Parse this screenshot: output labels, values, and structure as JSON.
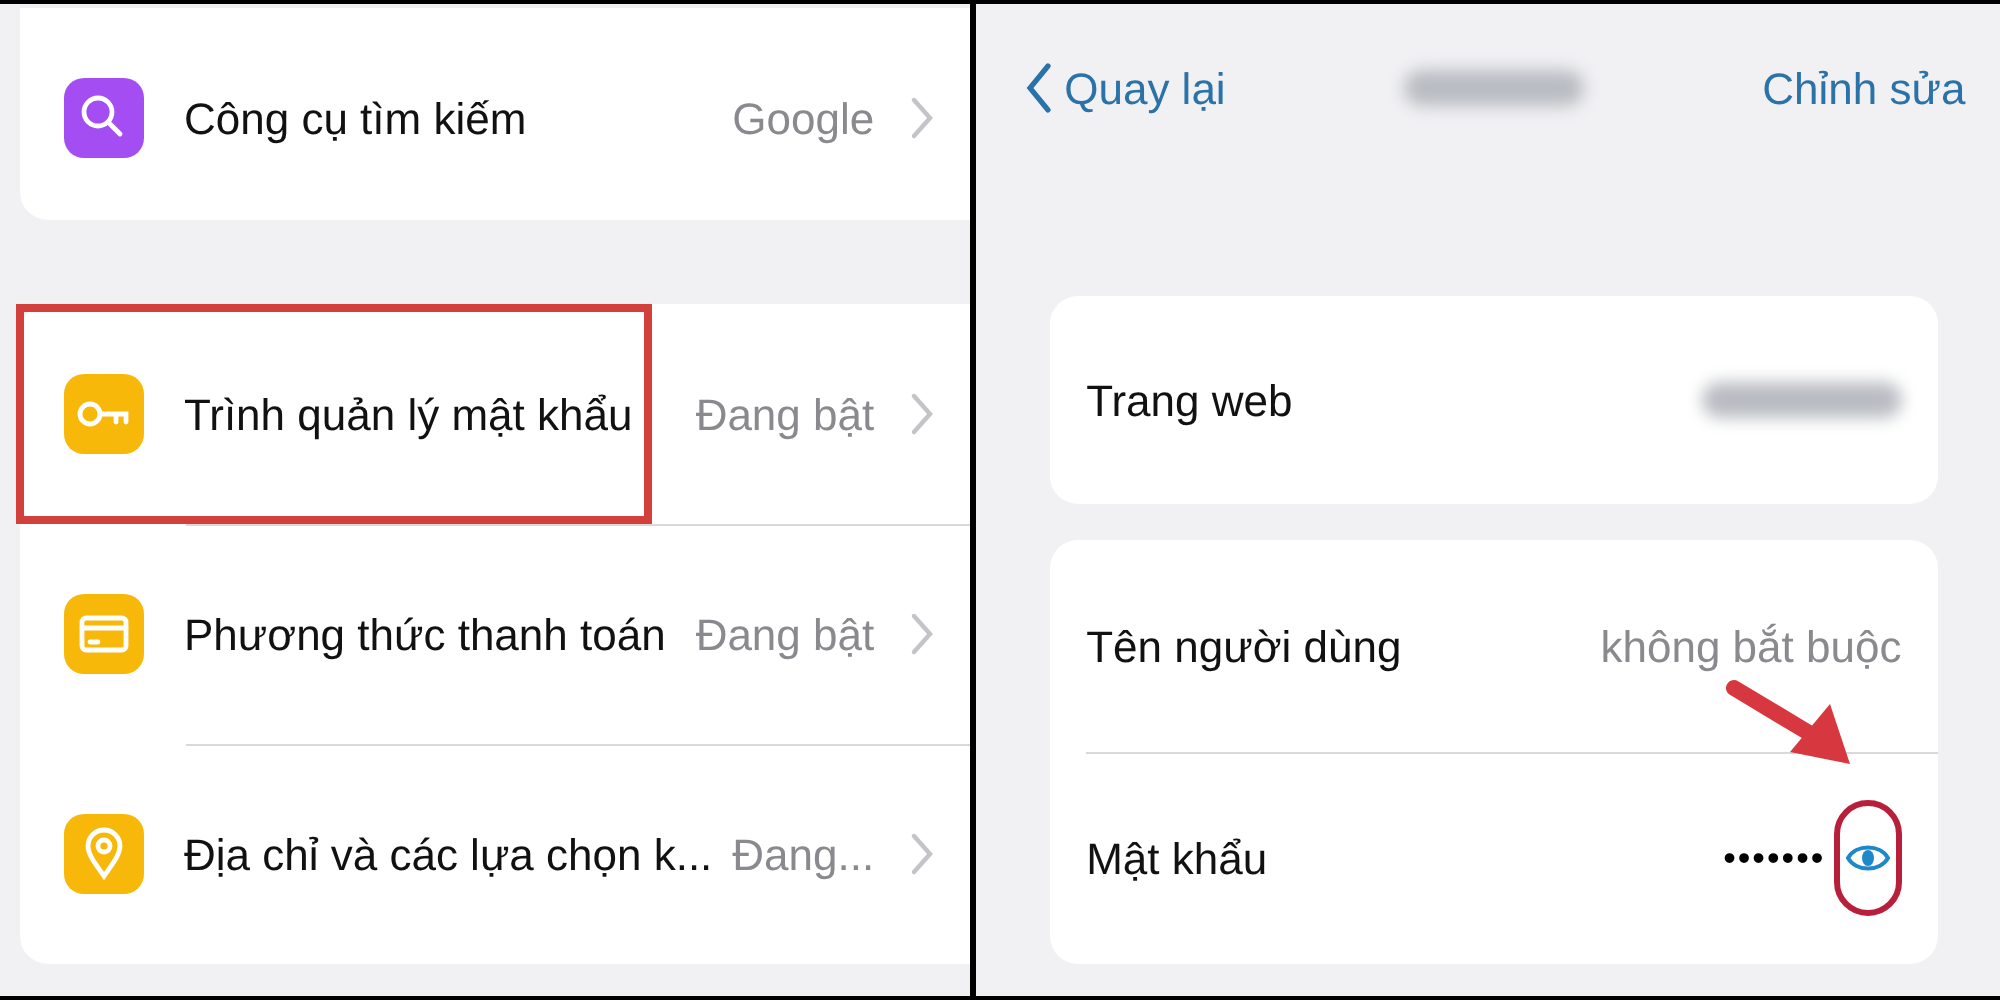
{
  "settings_panel": {
    "cards": [
      {
        "rows": [
          {
            "kind": "search",
            "color": "#a34df2",
            "label": "Công cụ tìm kiếm",
            "value": "Google",
            "highlighted": false
          }
        ]
      },
      {
        "rows": [
          {
            "kind": "key",
            "color": "#f8b80a",
            "label": "Trình quản lý mật khẩu",
            "value": "Đang bật",
            "highlighted": true
          },
          {
            "kind": "card",
            "color": "#f8b80a",
            "label": "Phương thức thanh toán",
            "value": "Đang bật",
            "highlighted": false
          },
          {
            "kind": "pin",
            "color": "#f8b80a",
            "label": "Địa chỉ và các lựa chọn k...",
            "value": "Đang...",
            "highlighted": false
          }
        ]
      }
    ]
  },
  "password_panel": {
    "back": "Quay lại",
    "edit": "Chỉnh sửa",
    "cards": [
      {
        "rows": [
          {
            "label": "Trang web",
            "kind": "blurred"
          }
        ]
      },
      {
        "rows": [
          {
            "label": "Tên người dùng",
            "kind": "text",
            "placeholder": "không bắt buộc"
          },
          {
            "label": "Mật khẩu",
            "kind": "password",
            "value": "•••••••",
            "annotated": true
          }
        ]
      }
    ]
  }
}
